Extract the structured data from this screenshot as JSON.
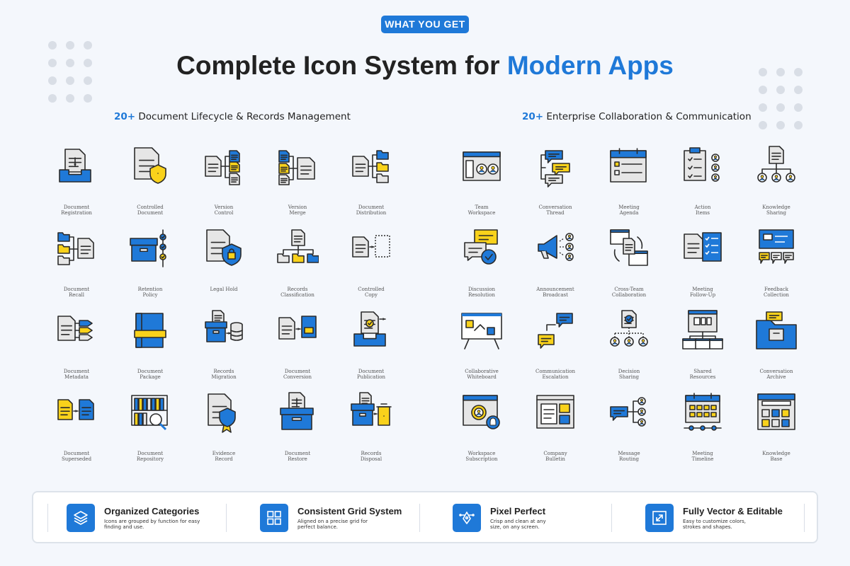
{
  "badge": "WHAT YOU GET",
  "headline": {
    "main": "Complete Icon System for ",
    "accent": "Modern Apps"
  },
  "colors": {
    "primary": "#1f79d8",
    "yellow": "#f9d21b",
    "fill_gray": "#e6e6e6",
    "outline": "#2b2b2b",
    "background": "#f4f7fc"
  },
  "left_section": {
    "count": "20+",
    "title": "Document Lifecycle & Records Management",
    "icons": [
      {
        "label": "Document\nRegistration",
        "icon": "document-tray-download-icon"
      },
      {
        "label": "Controlled\nDocument",
        "icon": "document-shield-check-icon"
      },
      {
        "label": "Version\nControl",
        "icon": "document-branch-icon"
      },
      {
        "label": "Version\nMerge",
        "icon": "documents-merge-icon"
      },
      {
        "label": "Document\nDistribution",
        "icon": "document-to-folders-icon"
      },
      {
        "label": "Document\nRecall",
        "icon": "folders-to-document-icon"
      },
      {
        "label": "Retention\nPolicy",
        "icon": "archive-box-timeline-icon"
      },
      {
        "label": "Legal Hold",
        "icon": "document-lock-shield-icon"
      },
      {
        "label": "Records\nClassification",
        "icon": "document-tree-folders-icon"
      },
      {
        "label": "Controlled\nCopy",
        "icon": "document-copy-icon"
      },
      {
        "label": "Document\nMetadata",
        "icon": "document-tags-icon"
      },
      {
        "label": "Document\nPackage",
        "icon": "binder-strap-icon"
      },
      {
        "label": "Records\nMigration",
        "icon": "box-to-database-icon"
      },
      {
        "label": "Document\nConversion",
        "icon": "document-to-spreadsheet-icon"
      },
      {
        "label": "Document\nPublication",
        "icon": "tray-document-check-icon"
      },
      {
        "label": "Document\nSuperseded",
        "icon": "document-replace-icon"
      },
      {
        "label": "Document\nRepository",
        "icon": "bookshelf-magnifier-icon"
      },
      {
        "label": "Evidence\nRecord",
        "icon": "document-ribbon-shield-icon"
      },
      {
        "label": "Document\nRestore",
        "icon": "box-upload-document-icon"
      },
      {
        "label": "Records\nDisposal",
        "icon": "box-to-trash-icon"
      }
    ]
  },
  "right_section": {
    "count": "20+",
    "title": "Enterprise Collaboration & Communication",
    "icons": [
      {
        "label": "Team\nWorkspace",
        "icon": "browser-team-icon"
      },
      {
        "label": "Conversation\nThread",
        "icon": "chat-thread-icon"
      },
      {
        "label": "Meeting\nAgenda",
        "icon": "calendar-agenda-icon"
      },
      {
        "label": "Action\nItems",
        "icon": "clipboard-checklist-users-icon"
      },
      {
        "label": "Knowledge\nSharing",
        "icon": "document-share-users-icon"
      },
      {
        "label": "Discussion\nResolution",
        "icon": "chat-bubbles-check-icon"
      },
      {
        "label": "Announcement\nBroadcast",
        "icon": "megaphone-users-icon"
      },
      {
        "label": "Cross-Team\nCollaboration",
        "icon": "windows-cycle-icon"
      },
      {
        "label": "Meeting\nFollow-Up",
        "icon": "document-checklist-icon"
      },
      {
        "label": "Feedback\nCollection",
        "icon": "board-chat-bubbles-icon"
      },
      {
        "label": "Collaborative\nWhiteboard",
        "icon": "whiteboard-icon"
      },
      {
        "label": "Communication\nEscalation",
        "icon": "chat-escalation-icon"
      },
      {
        "label": "Decision\nSharing",
        "icon": "decision-users-icon"
      },
      {
        "label": "Shared\nResources",
        "icon": "window-shared-resources-icon"
      },
      {
        "label": "Conversation\nArchive",
        "icon": "folder-chat-archive-icon"
      },
      {
        "label": "Workspace\nSubscription",
        "icon": "browser-user-bell-icon"
      },
      {
        "label": "Company\nBulletin",
        "icon": "bulletin-board-icon"
      },
      {
        "label": "Message\nRouting",
        "icon": "chat-routing-users-icon"
      },
      {
        "label": "Meeting\nTimeline",
        "icon": "calendar-timeline-icon"
      },
      {
        "label": "Knowledge\nBase",
        "icon": "browser-search-cards-icon"
      }
    ]
  },
  "features": [
    {
      "title": "Organized Categories",
      "desc": "Icons are grouped by function for easy finding and use.",
      "icon": "layers-icon"
    },
    {
      "title": "Consistent Grid System",
      "desc": "Aligned on a precise grid for perfect balance.",
      "icon": "grid-icon"
    },
    {
      "title": "Pixel Perfect",
      "desc": "Crisp and clean at any size, on any screen.",
      "icon": "pen-tool-icon"
    },
    {
      "title": "Fully Vector & Editable",
      "desc": "Easy to customize colors, strokes and shapes.",
      "icon": "expand-icon"
    }
  ]
}
